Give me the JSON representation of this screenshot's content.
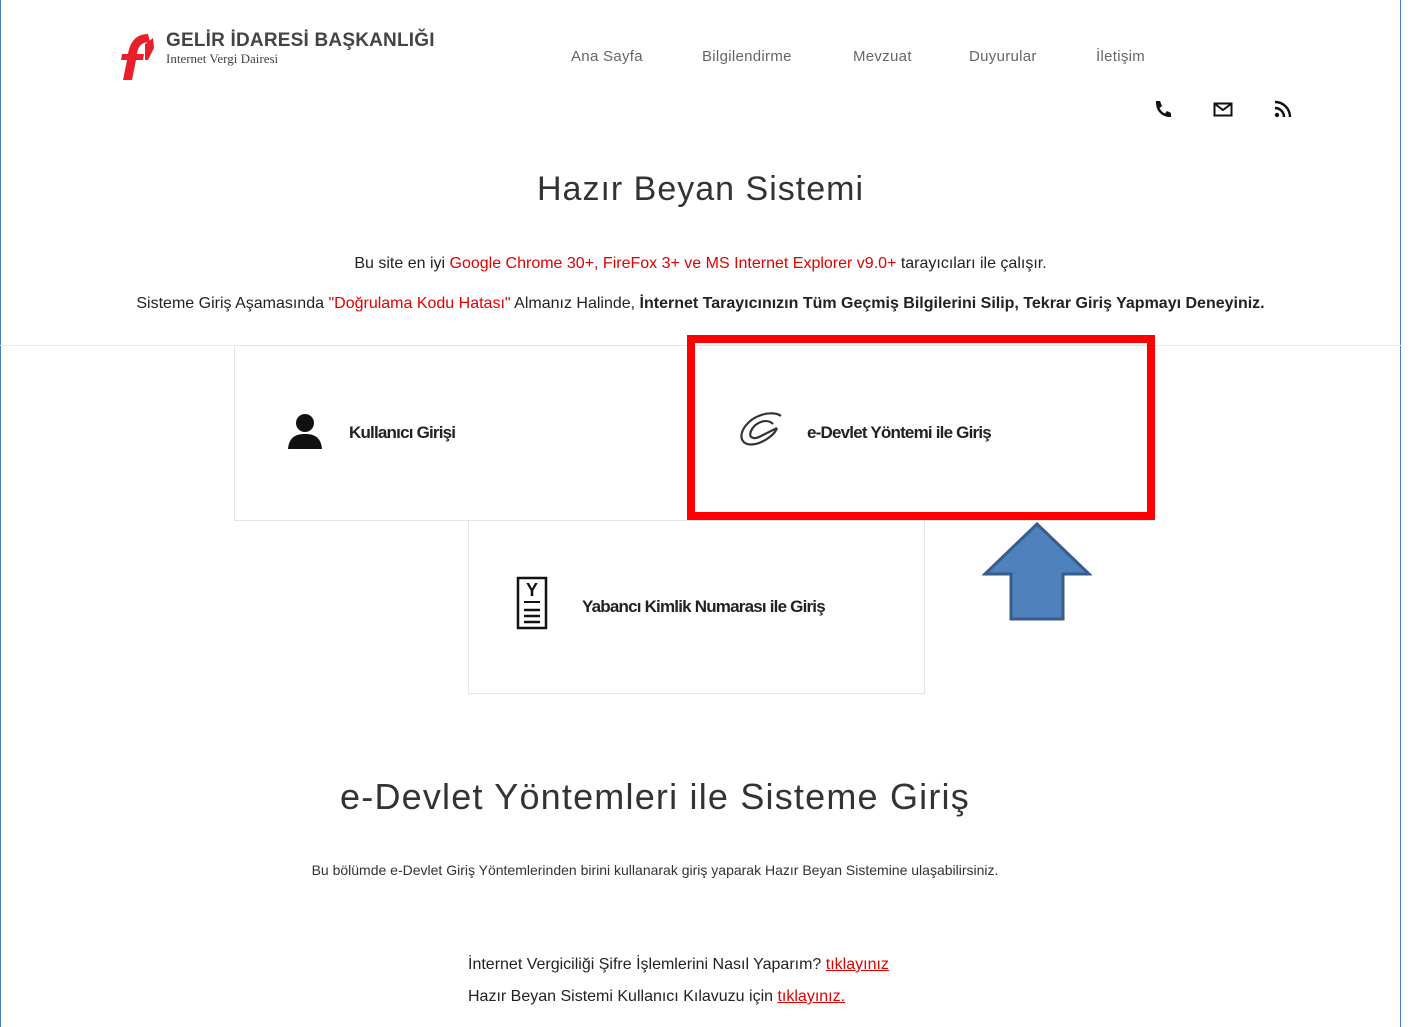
{
  "header": {
    "org_title": "GELİR İDARESİ BAŞKANLIĞI",
    "org_subtitle": "Internet Vergi Dairesi",
    "nav": [
      "Ana Sayfa",
      "Bilgilendirme",
      "Mevzuat",
      "Duyurular",
      "İletişim"
    ],
    "icons": [
      "phone-icon",
      "mail-icon",
      "rss-icon"
    ]
  },
  "main": {
    "title": "Hazır Beyan Sistemi",
    "browser_note": {
      "prefix": "Bu site en iyi ",
      "browsers": "Google Chrome 30+, FireFox 3+ ve MS Internet Explorer v9.0+",
      "suffix": " tarayıcıları ile çalışır."
    },
    "error_note": {
      "prefix": "Sisteme Giriş Aşamasında ",
      "error": "\"Doğrulama Kodu Hatası\"",
      "middle": " Almanız Halinde, ",
      "advice": "İnternet Tarayıcınızın Tüm Geçmiş Bilgilerini Silip, Tekrar Giriş Yapmayı Deneyiniz."
    },
    "login_options": {
      "user_login": "Kullanıcı Girişi",
      "edevlet_login": "e-Devlet Yöntemi ile Giriş",
      "foreign_id_login": "Yabancı Kimlik Numarası ile Giriş",
      "foreign_id_icon_letter": "Y"
    }
  },
  "edevlet_section": {
    "title": "e-Devlet Yöntemleri ile Sisteme Giriş",
    "description": "Bu bölümde e-Devlet Giriş Yöntemlerinden birini kullanarak giriş yaparak Hazır Beyan Sistemine ulaşabilirsiniz.",
    "help1_text": "İnternet Vergiciliği Şifre İşlemlerini Nasıl Yaparım? ",
    "help1_link": "tıklayınız",
    "help2_text": "Hazır Beyan Sistemi Kullanıcı Kılavuzu için ",
    "help2_link": "tıklayınız."
  },
  "colors": {
    "accent_red": "#e00000",
    "highlight_border": "#ff0000",
    "arrow_fill": "#4f81bd",
    "arrow_stroke": "#385d8a"
  }
}
